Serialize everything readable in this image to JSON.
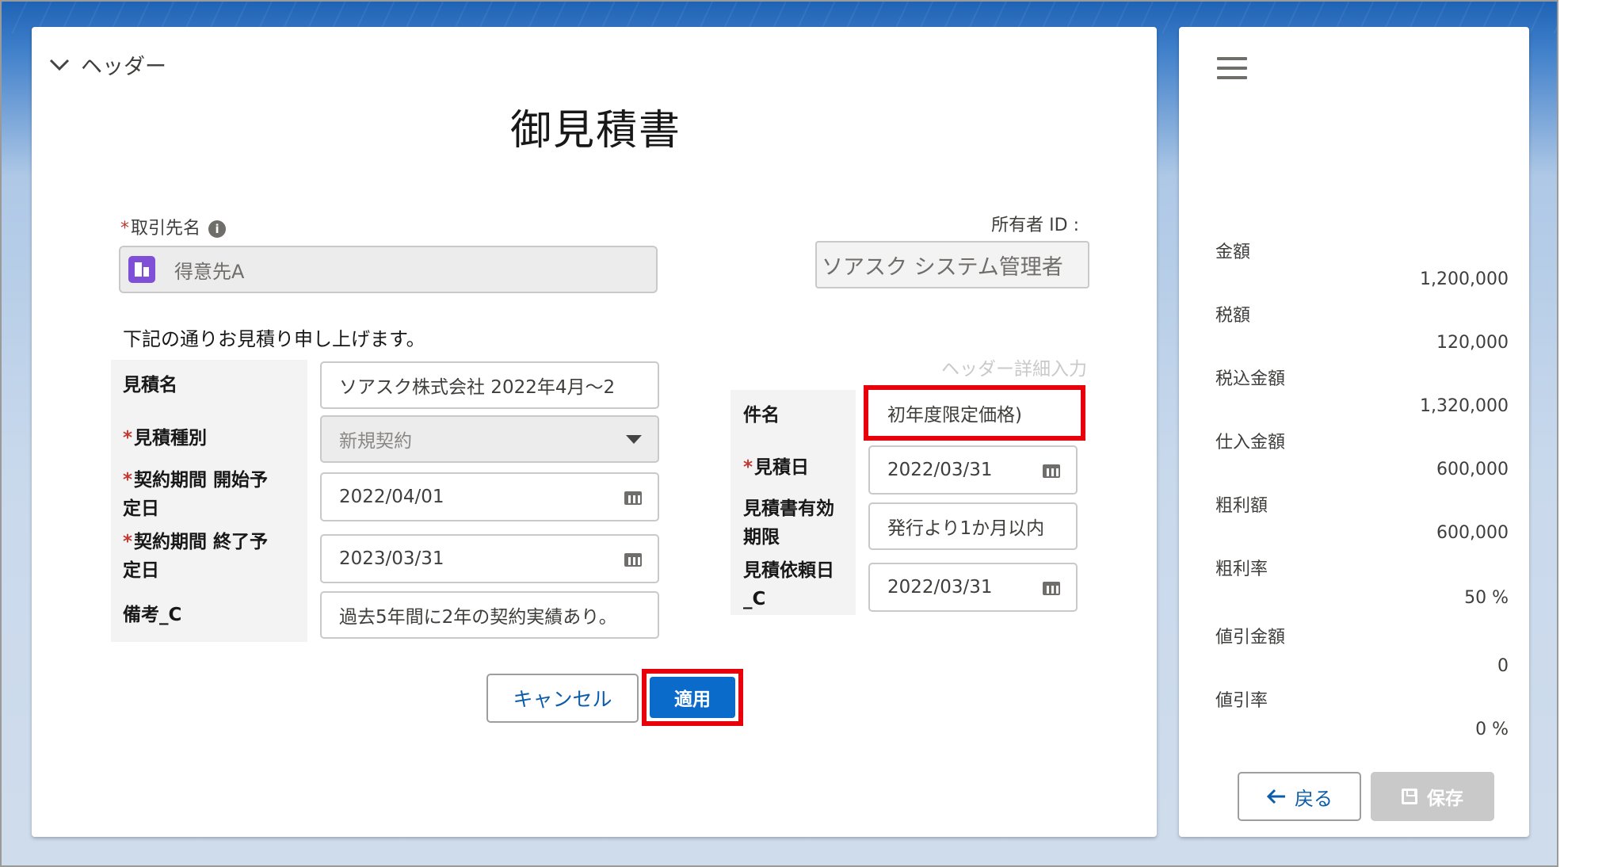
{
  "header": {
    "toggle_label": "ヘッダー",
    "title": "御見積書"
  },
  "account": {
    "label": "取引先名",
    "required_mark": "*",
    "info_icon": "i",
    "value": "得意先A"
  },
  "owner": {
    "label": "所有者 ID :",
    "value": "ソアスク システム管理者"
  },
  "intro_text": "下記の通りお見積り申し上げます。",
  "left_fields": {
    "quote_name": {
      "label": "見積名",
      "value": "ソアスク株式会社 2022年4月～2"
    },
    "quote_type": {
      "label": "見積種別",
      "required_mark": "*",
      "value": "新規契約"
    },
    "start_date": {
      "label_line1": "契約期間 開始予",
      "label_line2": "定日",
      "required_mark": "*",
      "value": "2022/04/01"
    },
    "end_date": {
      "label_line1": "契約期間 終了予",
      "label_line2": "定日",
      "required_mark": "*",
      "value": "2023/03/31"
    },
    "remarks": {
      "label": "備考_C",
      "value": "過去5年間に2年の契約実績あり。"
    }
  },
  "header_detail_label": "ヘッダー詳細入力",
  "right_fields": {
    "subject": {
      "label": "件名",
      "value": "初年度限定価格)"
    },
    "quote_date": {
      "label": "見積日",
      "required_mark": "*",
      "value": "2022/03/31"
    },
    "validity": {
      "label_line1": "見積書有効",
      "label_line2": "期限",
      "value": "発行より1か月以内"
    },
    "request_date": {
      "label_line1": "見積依頼日",
      "label_line2": "_C",
      "value": "2022/03/31"
    }
  },
  "buttons": {
    "cancel": "キャンセル",
    "apply": "適用",
    "back": "戻る",
    "save": "保存"
  },
  "summary": [
    {
      "label": "金額",
      "value": "1,200,000"
    },
    {
      "label": "税額",
      "value": "120,000"
    },
    {
      "label": "税込金額",
      "value": "1,320,000"
    },
    {
      "label": "仕入金額",
      "value": "600,000"
    },
    {
      "label": "粗利額",
      "value": "600,000"
    },
    {
      "label": "粗利率",
      "value": "50 %"
    },
    {
      "label": "値引金額",
      "value": "0"
    },
    {
      "label": "値引率",
      "value": "0 %"
    }
  ],
  "colors": {
    "brand_blue": "#0b6bcb",
    "highlight_red": "#e8000b",
    "lookup_icon": "#7f4fd8"
  },
  "icons": [
    "chevron-down-icon",
    "info-icon",
    "account-icon",
    "calendar-icon",
    "dropdown-caret-icon",
    "hamburger-menu-icon",
    "arrow-left-icon",
    "save-icon"
  ]
}
